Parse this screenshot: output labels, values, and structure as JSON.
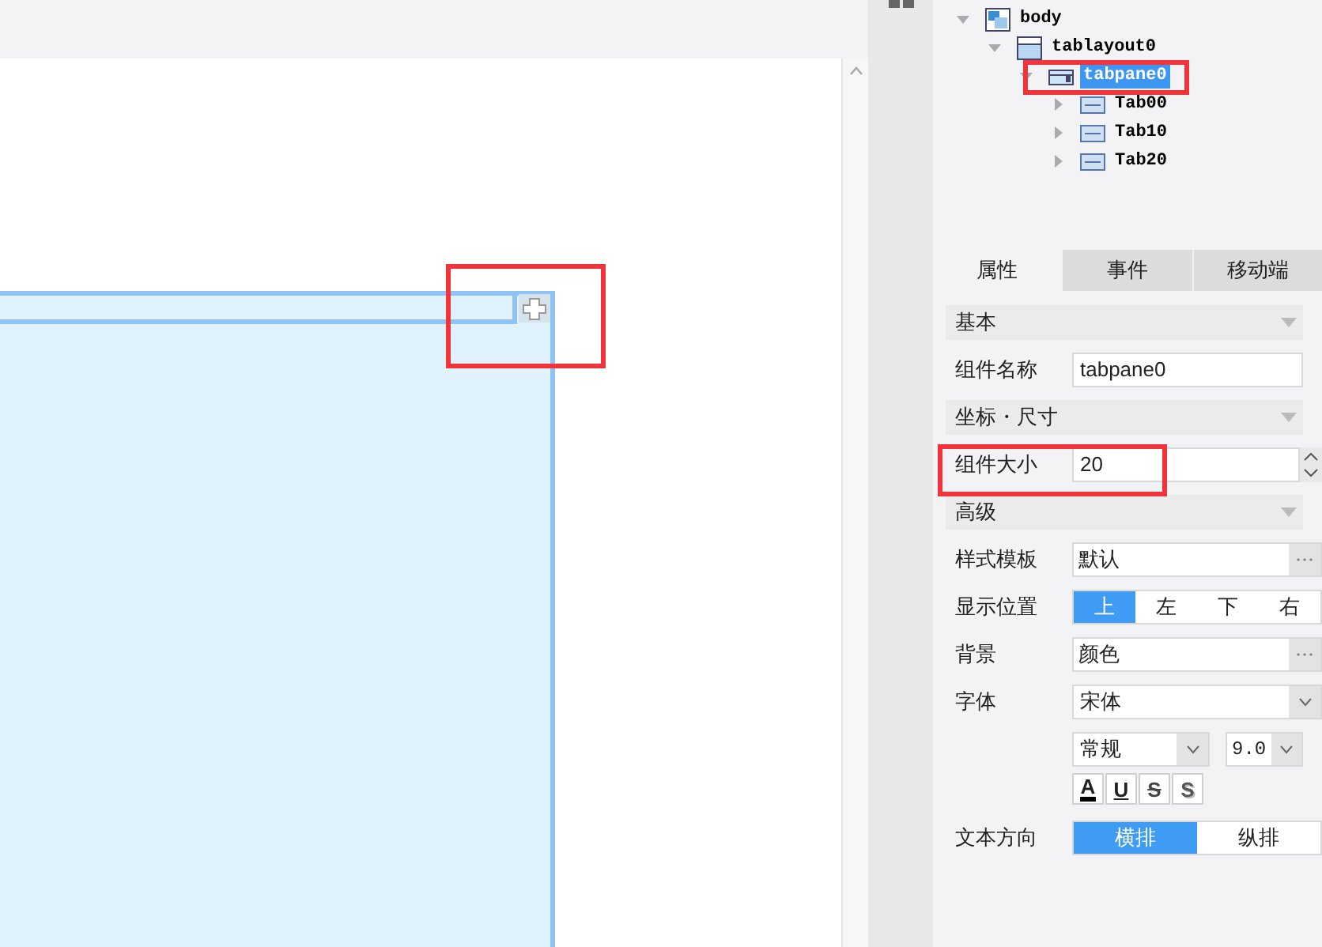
{
  "tree": [
    {
      "label": "body",
      "expanded": true,
      "selected": false,
      "children": [
        {
          "label": "tablayout0",
          "expanded": true,
          "selected": false,
          "children": [
            {
              "label": "tabpane0",
              "expanded": true,
              "selected": true,
              "children": [
                {
                  "label": "Tab00",
                  "expanded": false,
                  "selected": false
                },
                {
                  "label": "Tab10",
                  "expanded": false,
                  "selected": false
                },
                {
                  "label": "Tab20",
                  "expanded": false,
                  "selected": false
                }
              ]
            }
          ]
        }
      ]
    }
  ],
  "panel_tabs": [
    {
      "label": "属性",
      "selected": true
    },
    {
      "label": "事件",
      "selected": false
    },
    {
      "label": "移动端",
      "selected": false
    }
  ],
  "properties": [
    {
      "kind": "section",
      "label": "基本"
    },
    {
      "kind": "text",
      "label": "组件名称",
      "value": "tabpane0"
    },
    {
      "kind": "section",
      "label": "坐标・尺寸"
    },
    {
      "kind": "spinner",
      "label": "组件大小",
      "value": "20"
    },
    {
      "kind": "section",
      "label": "高级"
    },
    {
      "kind": "picker",
      "label": "样式模板",
      "value": "默认"
    },
    {
      "kind": "segmented",
      "label": "显示位置",
      "options": [
        {
          "label": "上",
          "selected": true
        },
        {
          "label": "左",
          "selected": false
        },
        {
          "label": "下",
          "selected": false
        },
        {
          "label": "右",
          "selected": false
        }
      ]
    },
    {
      "kind": "picker",
      "label": "背景",
      "value": "颜色"
    },
    {
      "kind": "font",
      "label": "字体",
      "family": "宋体",
      "style": "常规",
      "size": "9.0",
      "styles": [
        {
          "label": "A",
          "kind": "color"
        },
        {
          "label": "U",
          "kind": "underline"
        },
        {
          "label": "S",
          "kind": "strike"
        },
        {
          "label": "S",
          "kind": "shadow"
        }
      ]
    },
    {
      "kind": "segmented",
      "label": "文本方向",
      "options": [
        {
          "label": "横排",
          "selected": true
        },
        {
          "label": "纵排",
          "selected": false
        }
      ]
    }
  ]
}
